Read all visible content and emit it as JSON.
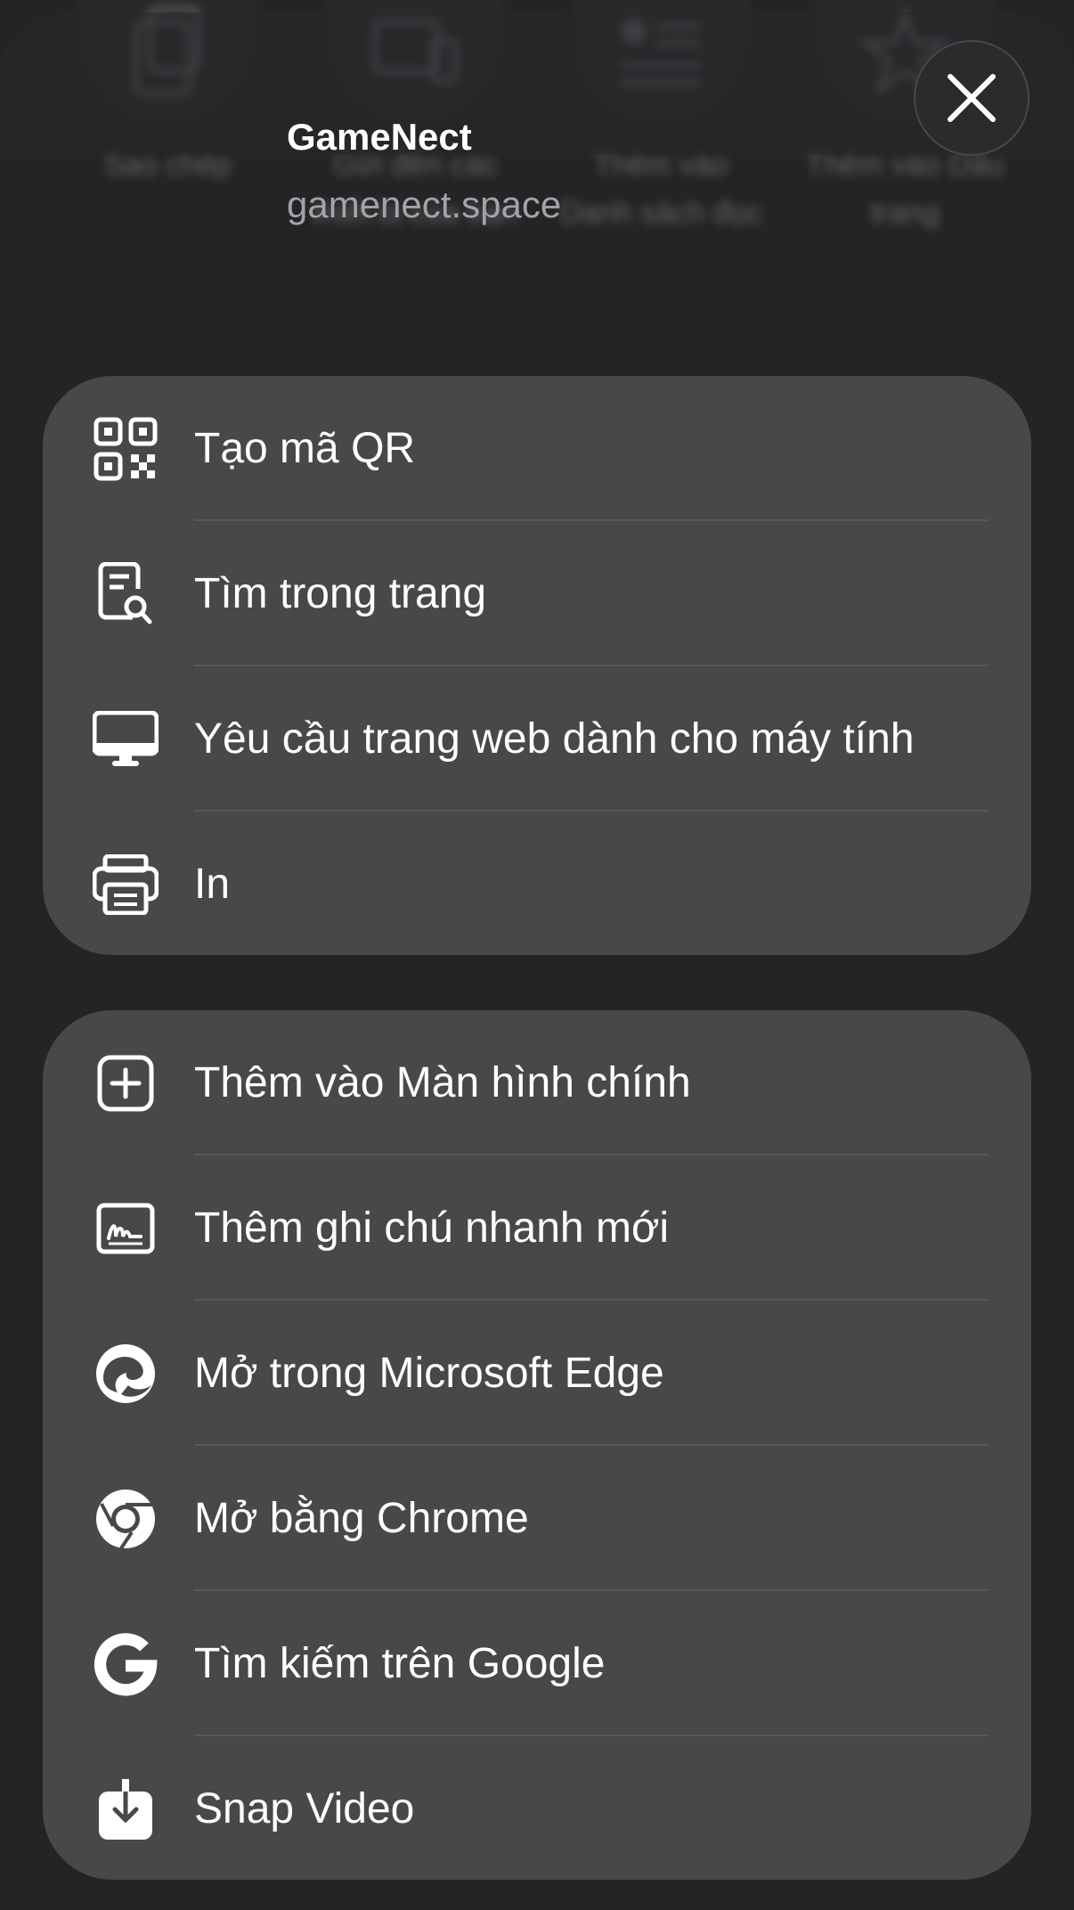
{
  "header": {
    "site_title": "GameNect",
    "site_url": "gamenect.space",
    "close_icon": "close-icon"
  },
  "background_actions": [
    {
      "label": "Sao chép",
      "icon": "copy-icon"
    },
    {
      "label": "Gửi đến các thiết bị của bạn",
      "icon": "devices-icon"
    },
    {
      "label": "Thêm vào Danh sách đọc",
      "icon": "reading-list-icon"
    },
    {
      "label": "Thêm vào Dấu trang",
      "icon": "star-icon"
    }
  ],
  "group1": {
    "items": [
      {
        "label": "Tạo mã QR",
        "icon": "qr-code-icon"
      },
      {
        "label": "Tìm trong trang",
        "icon": "find-in-page-icon"
      },
      {
        "label": "Yêu cầu trang web dành cho máy tính",
        "icon": "desktop-icon"
      },
      {
        "label": "In",
        "icon": "printer-icon"
      }
    ]
  },
  "group2": {
    "items": [
      {
        "label": "Thêm vào Màn hình chính",
        "icon": "add-square-icon"
      },
      {
        "label": "Thêm ghi chú nhanh mới",
        "icon": "quick-note-icon"
      },
      {
        "label": "Mở trong Microsoft Edge",
        "icon": "edge-icon"
      },
      {
        "label": "Mở bằng Chrome",
        "icon": "chrome-icon"
      },
      {
        "label": "Tìm kiếm trên Google",
        "icon": "google-icon"
      },
      {
        "label": "Snap Video",
        "icon": "download-icon"
      }
    ]
  }
}
